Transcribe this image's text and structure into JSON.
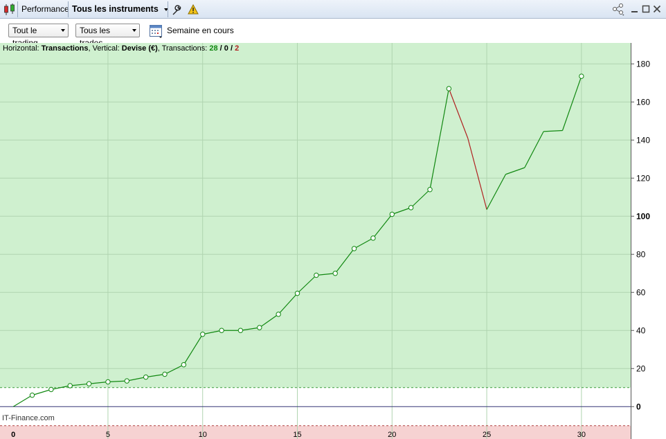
{
  "window": {
    "tab_performance": "Performance",
    "instrument_selector": "Tous les instruments",
    "icons": [
      "candlestick-chart-icon",
      "wrench-icon",
      "warning-icon",
      "share-icon",
      "minimize-icon",
      "maximize-icon",
      "close-icon"
    ]
  },
  "toolbar": {
    "trading_filter": "Tout le trading",
    "trades_filter": "Tous les trades",
    "period_label": "Semaine en cours"
  },
  "info": {
    "h_prefix": "Horizontal: ",
    "h_value": "Transactions",
    "v_prefix": ", Vertical: ",
    "v_value": "Devise (€)",
    "t_prefix": ", Transactions: ",
    "win": "28",
    "sep1": " / ",
    "neutral": "0",
    "sep2": " / ",
    "loss": "2"
  },
  "watermark": "IT-Finance.com",
  "colors": {
    "gain_zone": "#cff0cf",
    "loss_zone": "#f6d2d2",
    "gain_line": "#118811",
    "loss_line": "#b02020",
    "zero_line": "#333377"
  },
  "chart_data": {
    "type": "line",
    "x": [
      0,
      1,
      2,
      3,
      4,
      5,
      6,
      7,
      8,
      9,
      10,
      11,
      12,
      13,
      14,
      15,
      16,
      17,
      18,
      19,
      20,
      21,
      22,
      23,
      24,
      25,
      26,
      27,
      28,
      29,
      30
    ],
    "y": [
      0,
      6,
      9,
      11,
      12,
      13,
      13.5,
      15.5,
      17,
      22,
      38,
      40,
      40,
      41.5,
      48.5,
      59.5,
      69,
      70,
      83,
      88.5,
      101,
      104.5,
      114,
      167,
      141,
      103.5,
      122,
      125.5,
      144.5,
      145,
      173.5
    ],
    "markers_through_x": 23,
    "losing_segments_from_x": [
      23,
      24
    ],
    "x_ticks": [
      "0",
      "5",
      "10",
      "15",
      "20",
      "25",
      "30"
    ],
    "y_ticks": [
      "0",
      "20",
      "40",
      "60",
      "80",
      "100",
      "120",
      "140",
      "160",
      "180"
    ],
    "xlim": [
      -0.7,
      32.6
    ],
    "ylim": [
      -17,
      191
    ],
    "gain_threshold": 10,
    "loss_threshold": -10,
    "axis_position": "right",
    "grid": true
  }
}
